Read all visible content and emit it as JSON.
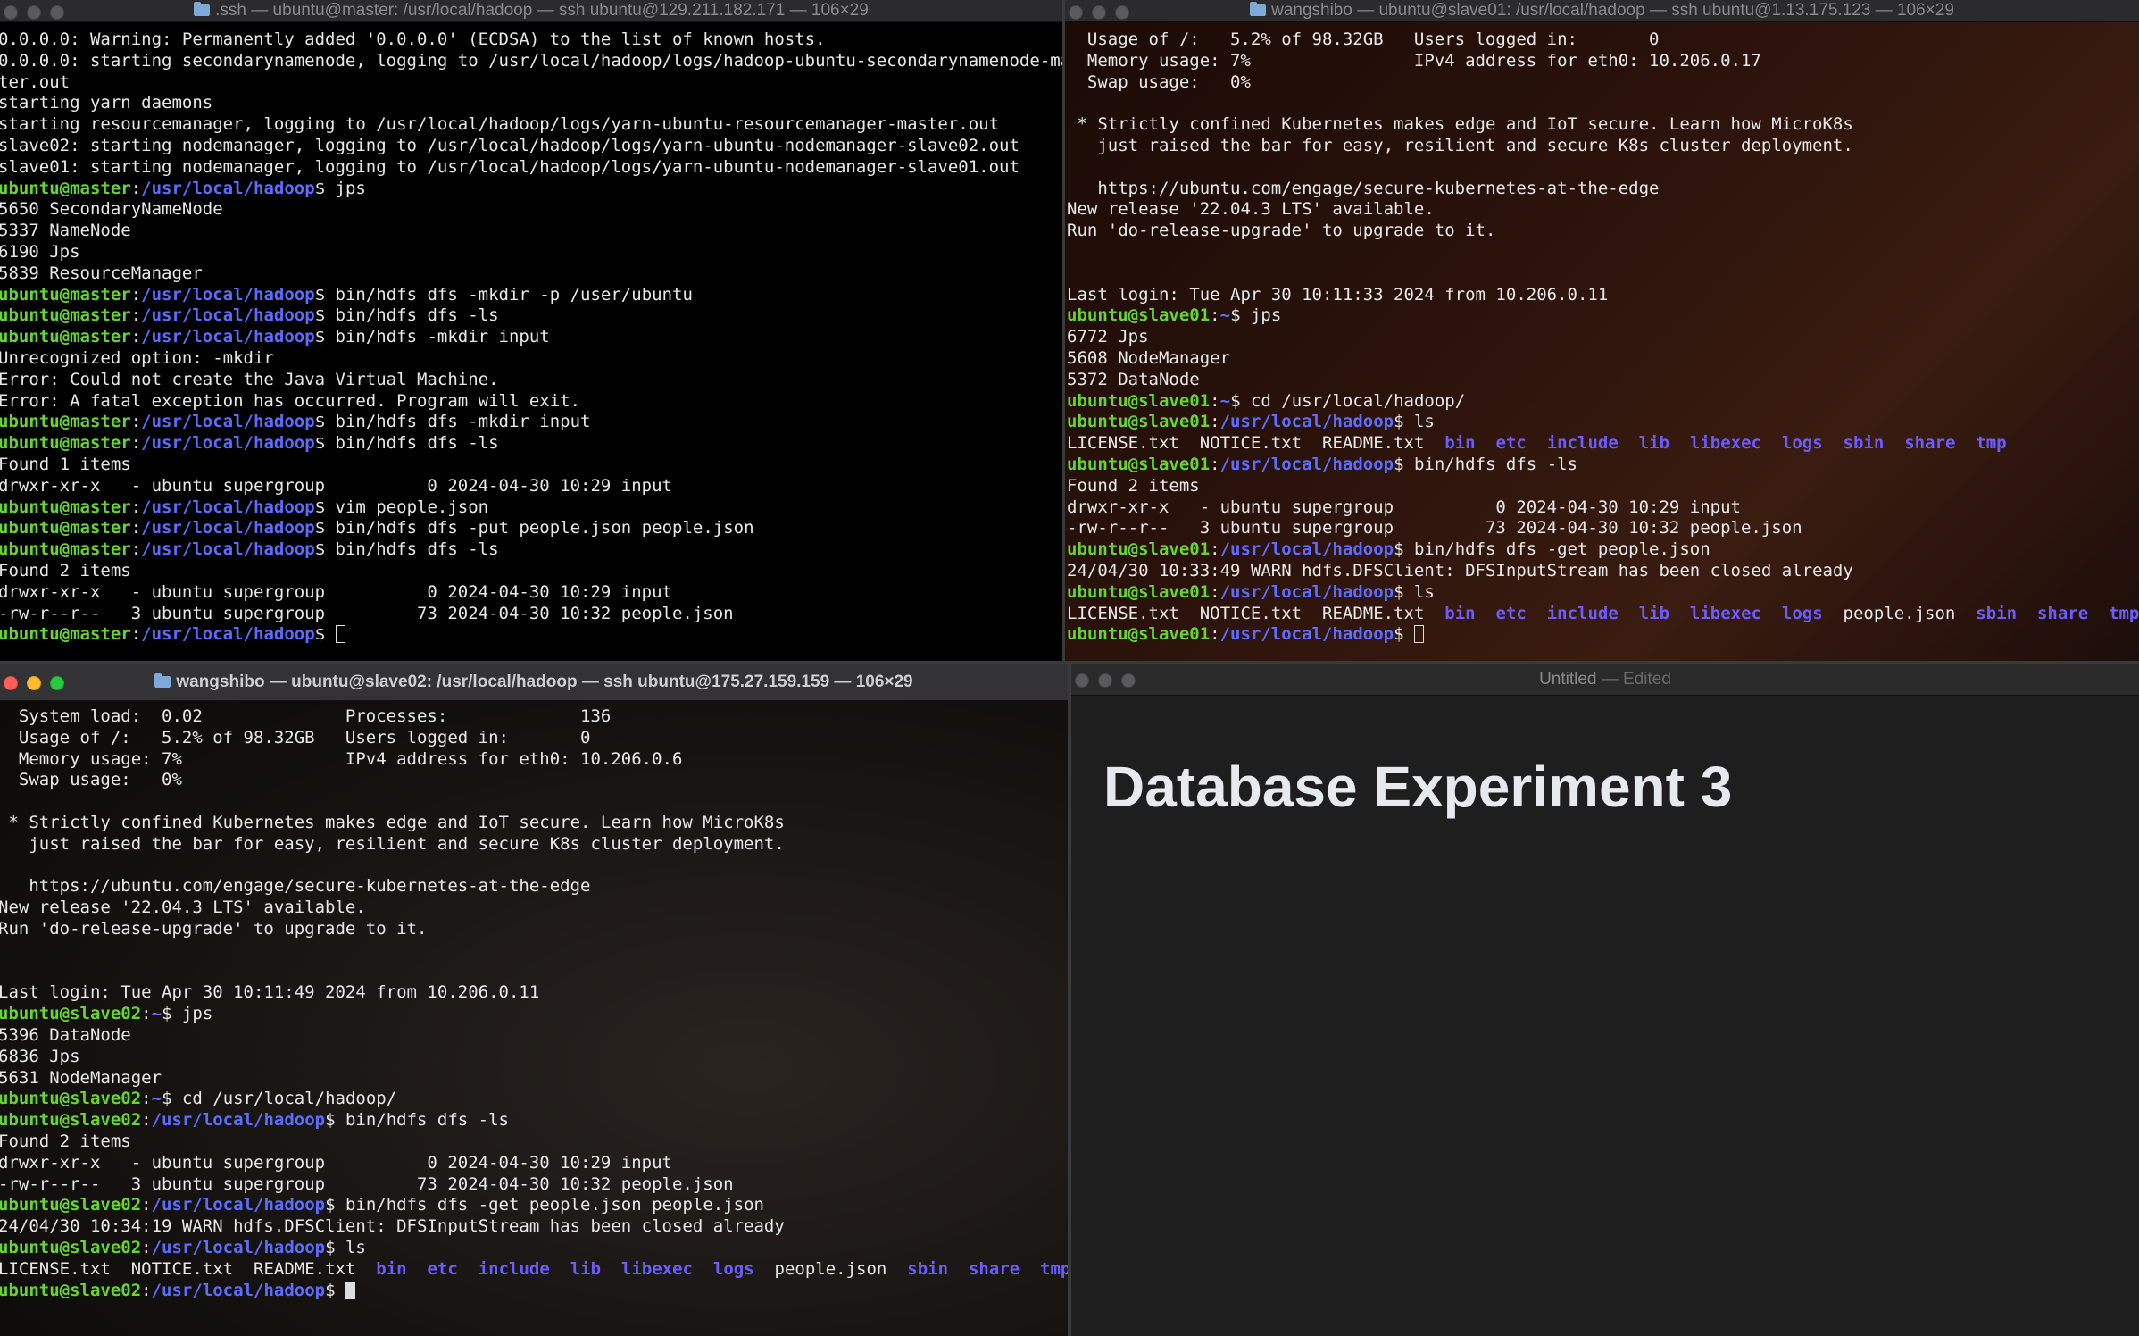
{
  "colors": {
    "prompt_user": "#66d431",
    "prompt_path": "#5c6cff",
    "dir": "#6b5cff"
  },
  "windows": {
    "master": {
      "title": ".ssh — ubuntu@master: /usr/local/hadoop — ssh ubuntu@129.211.182.171 — 106×29",
      "lines": [
        {
          "t": "0.0.0.0: Warning: Permanently added '0.0.0.0' (ECDSA) to the list of known hosts."
        },
        {
          "t": "0.0.0.0: starting secondarynamenode, logging to /usr/local/hadoop/logs/hadoop-ubuntu-secondarynamenode-mas"
        },
        {
          "t": "ter.out"
        },
        {
          "t": "starting yarn daemons"
        },
        {
          "t": "starting resourcemanager, logging to /usr/local/hadoop/logs/yarn-ubuntu-resourcemanager-master.out"
        },
        {
          "t": "slave02: starting nodemanager, logging to /usr/local/hadoop/logs/yarn-ubuntu-nodemanager-slave02.out"
        },
        {
          "t": "slave01: starting nodemanager, logging to /usr/local/hadoop/logs/yarn-ubuntu-nodemanager-slave01.out"
        },
        {
          "p": "ubuntu@master",
          "d": "/usr/local/hadoop",
          "c": "$ jps"
        },
        {
          "t": "5650 SecondaryNameNode"
        },
        {
          "t": "5337 NameNode"
        },
        {
          "t": "6190 Jps"
        },
        {
          "t": "5839 ResourceManager"
        },
        {
          "p": "ubuntu@master",
          "d": "/usr/local/hadoop",
          "c": "$ bin/hdfs dfs -mkdir -p /user/ubuntu"
        },
        {
          "p": "ubuntu@master",
          "d": "/usr/local/hadoop",
          "c": "$ bin/hdfs dfs -ls"
        },
        {
          "p": "ubuntu@master",
          "d": "/usr/local/hadoop",
          "c": "$ bin/hdfs -mkdir input"
        },
        {
          "t": "Unrecognized option: -mkdir"
        },
        {
          "t": "Error: Could not create the Java Virtual Machine."
        },
        {
          "t": "Error: A fatal exception has occurred. Program will exit."
        },
        {
          "p": "ubuntu@master",
          "d": "/usr/local/hadoop",
          "c": "$ bin/hdfs dfs -mkdir input"
        },
        {
          "p": "ubuntu@master",
          "d": "/usr/local/hadoop",
          "c": "$ bin/hdfs dfs -ls"
        },
        {
          "t": "Found 1 items"
        },
        {
          "t": "drwxr-xr-x   - ubuntu supergroup          0 2024-04-30 10:29 input"
        },
        {
          "p": "ubuntu@master",
          "d": "/usr/local/hadoop",
          "c": "$ vim people.json"
        },
        {
          "p": "ubuntu@master",
          "d": "/usr/local/hadoop",
          "c": "$ bin/hdfs dfs -put people.json people.json"
        },
        {
          "p": "ubuntu@master",
          "d": "/usr/local/hadoop",
          "c": "$ bin/hdfs dfs -ls"
        },
        {
          "t": "Found 2 items"
        },
        {
          "t": "drwxr-xr-x   - ubuntu supergroup          0 2024-04-30 10:29 input"
        },
        {
          "t": "-rw-r--r--   3 ubuntu supergroup         73 2024-04-30 10:32 people.json"
        },
        {
          "p": "ubuntu@master",
          "d": "/usr/local/hadoop",
          "c": "$ ",
          "cursor": "hollow"
        }
      ]
    },
    "slave01": {
      "title": "wangshibo — ubuntu@slave01: /usr/local/hadoop — ssh ubuntu@1.13.175.123 — 106×29",
      "lines": [
        {
          "t": "  Usage of /:   5.2% of 98.32GB   Users logged in:       0"
        },
        {
          "t": "  Memory usage: 7%                IPv4 address for eth0: 10.206.0.17"
        },
        {
          "t": "  Swap usage:   0%"
        },
        {
          "t": ""
        },
        {
          "t": " * Strictly confined Kubernetes makes edge and IoT secure. Learn how MicroK8s"
        },
        {
          "t": "   just raised the bar for easy, resilient and secure K8s cluster deployment."
        },
        {
          "t": ""
        },
        {
          "t": "   https://ubuntu.com/engage/secure-kubernetes-at-the-edge"
        },
        {
          "t": "New release '22.04.3 LTS' available."
        },
        {
          "t": "Run 'do-release-upgrade' to upgrade to it."
        },
        {
          "t": ""
        },
        {
          "t": ""
        },
        {
          "t": "Last login: Tue Apr 30 10:11:33 2024 from 10.206.0.11"
        },
        {
          "p": "ubuntu@slave01",
          "d": "~",
          "c": "$ jps"
        },
        {
          "t": "6772 Jps"
        },
        {
          "t": "5608 NodeManager"
        },
        {
          "t": "5372 DataNode"
        },
        {
          "p": "ubuntu@slave01",
          "d": "~",
          "c": "$ cd /usr/local/hadoop/"
        },
        {
          "p": "ubuntu@slave01",
          "d": "/usr/local/hadoop",
          "c": "$ ls"
        },
        {
          "ls": [
            "LICENSE.txt",
            "NOTICE.txt",
            "README.txt",
            "*bin",
            "*etc",
            "*include",
            "*lib",
            "*libexec",
            "*logs",
            "*sbin",
            "*share",
            "*tmp"
          ]
        },
        {
          "p": "ubuntu@slave01",
          "d": "/usr/local/hadoop",
          "c": "$ bin/hdfs dfs -ls"
        },
        {
          "t": "Found 2 items"
        },
        {
          "t": "drwxr-xr-x   - ubuntu supergroup          0 2024-04-30 10:29 input"
        },
        {
          "t": "-rw-r--r--   3 ubuntu supergroup         73 2024-04-30 10:32 people.json"
        },
        {
          "p": "ubuntu@slave01",
          "d": "/usr/local/hadoop",
          "c": "$ bin/hdfs dfs -get people.json"
        },
        {
          "t": "24/04/30 10:33:49 WARN hdfs.DFSClient: DFSInputStream has been closed already"
        },
        {
          "p": "ubuntu@slave01",
          "d": "/usr/local/hadoop",
          "c": "$ ls"
        },
        {
          "ls": [
            "LICENSE.txt",
            "NOTICE.txt",
            "README.txt",
            "*bin",
            "*etc",
            "*include",
            "*lib",
            "*libexec",
            "*logs",
            "people.json",
            "*sbin",
            "*share",
            "*tmp"
          ]
        },
        {
          "p": "ubuntu@slave01",
          "d": "/usr/local/hadoop",
          "c": "$ ",
          "cursor": "hollow"
        }
      ]
    },
    "slave02": {
      "title": "wangshibo — ubuntu@slave02: /usr/local/hadoop — ssh ubuntu@175.27.159.159 — 106×29",
      "lines": [
        {
          "t": "  System load:  0.02              Processes:             136"
        },
        {
          "t": "  Usage of /:   5.2% of 98.32GB   Users logged in:       0"
        },
        {
          "t": "  Memory usage: 7%                IPv4 address for eth0: 10.206.0.6"
        },
        {
          "t": "  Swap usage:   0%"
        },
        {
          "t": ""
        },
        {
          "t": " * Strictly confined Kubernetes makes edge and IoT secure. Learn how MicroK8s"
        },
        {
          "t": "   just raised the bar for easy, resilient and secure K8s cluster deployment."
        },
        {
          "t": ""
        },
        {
          "t": "   https://ubuntu.com/engage/secure-kubernetes-at-the-edge"
        },
        {
          "t": "New release '22.04.3 LTS' available."
        },
        {
          "t": "Run 'do-release-upgrade' to upgrade to it."
        },
        {
          "t": ""
        },
        {
          "t": ""
        },
        {
          "t": "Last login: Tue Apr 30 10:11:49 2024 from 10.206.0.11"
        },
        {
          "p": "ubuntu@slave02",
          "d": "~",
          "c": "$ jps"
        },
        {
          "t": "5396 DataNode"
        },
        {
          "t": "6836 Jps"
        },
        {
          "t": "5631 NodeManager"
        },
        {
          "p": "ubuntu@slave02",
          "d": "~",
          "c": "$ cd /usr/local/hadoop/"
        },
        {
          "p": "ubuntu@slave02",
          "d": "/usr/local/hadoop",
          "c": "$ bin/hdfs dfs -ls"
        },
        {
          "t": "Found 2 items"
        },
        {
          "t": "drwxr-xr-x   - ubuntu supergroup          0 2024-04-30 10:29 input"
        },
        {
          "t": "-rw-r--r--   3 ubuntu supergroup         73 2024-04-30 10:32 people.json"
        },
        {
          "p": "ubuntu@slave02",
          "d": "/usr/local/hadoop",
          "c": "$ bin/hdfs dfs -get people.json people.json"
        },
        {
          "t": "24/04/30 10:34:19 WARN hdfs.DFSClient: DFSInputStream has been closed already"
        },
        {
          "p": "ubuntu@slave02",
          "d": "/usr/local/hadoop",
          "c": "$ ls"
        },
        {
          "ls": [
            "LICENSE.txt",
            "NOTICE.txt",
            "README.txt",
            "*bin",
            "*etc",
            "*include",
            "*lib",
            "*libexec",
            "*logs",
            "people.json",
            "*sbin",
            "*share",
            "*tmp"
          ]
        },
        {
          "p": "ubuntu@slave02",
          "d": "/usr/local/hadoop",
          "c": "$ ",
          "cursor": "solid"
        }
      ]
    },
    "editor": {
      "title": "Untitled",
      "title_sep": " — ",
      "title_state": "Edited",
      "heading": "Database Experiment 3"
    }
  }
}
